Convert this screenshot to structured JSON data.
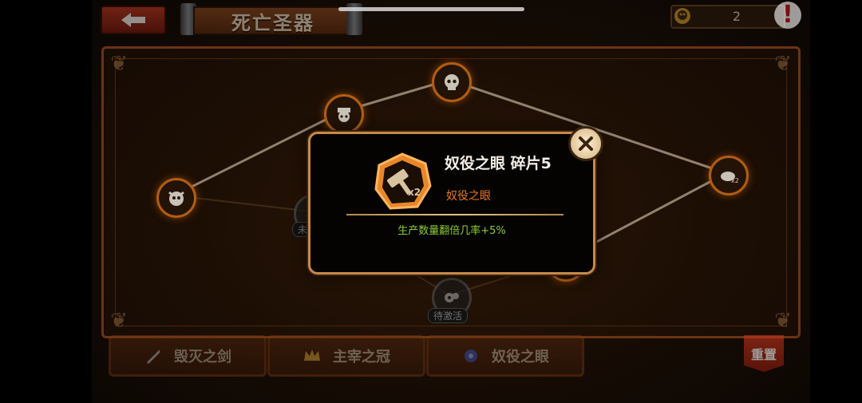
{
  "header": {
    "title": "死亡圣器",
    "currency_count": "2"
  },
  "nodes": {
    "pending_label": "待激活",
    "partial_label": "未"
  },
  "tabs": [
    {
      "label": "毁灭之剑",
      "icon": "sword-icon"
    },
    {
      "label": "主宰之冠",
      "icon": "crown-icon"
    },
    {
      "label": "奴役之眼",
      "icon": "eye-gem-icon"
    }
  ],
  "reset_label": "重置",
  "modal": {
    "title": "奴役之眼 碎片5",
    "subtitle": "奴役之眼",
    "description": "生产数量翻倍几率+5%",
    "badge_text": "x2",
    "badge_icon": "hammer-icon"
  },
  "colors": {
    "accent_orange": "#e27a24",
    "desc_green": "#8ccc3a",
    "modal_border": "#c58a4c"
  }
}
